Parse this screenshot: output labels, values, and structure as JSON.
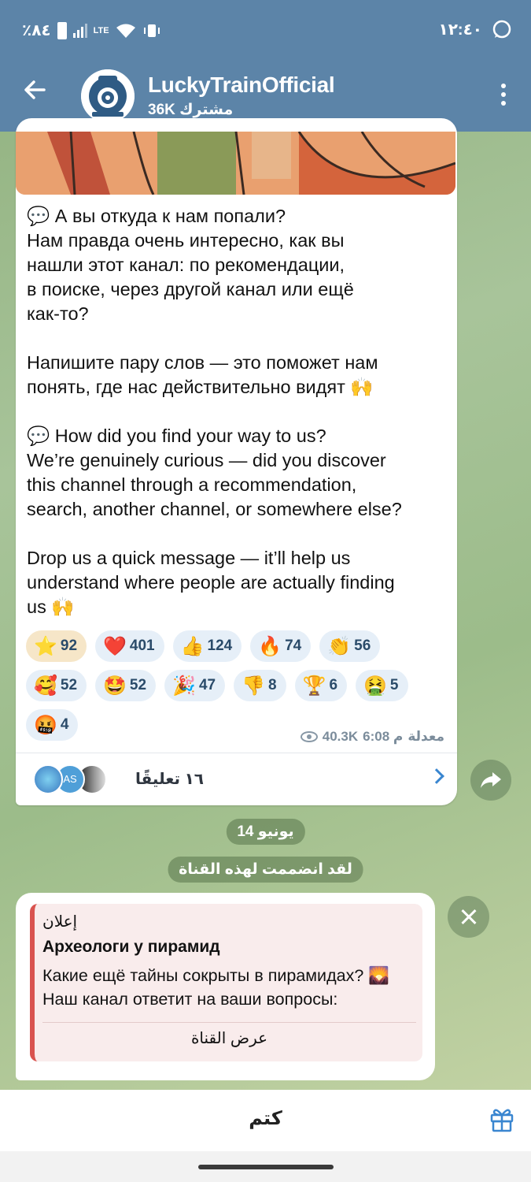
{
  "status_bar": {
    "battery": "٪٨٤",
    "network": "LTE",
    "time": "١٢:٤٠",
    "whatsapp_icon": "whatsapp-icon"
  },
  "header": {
    "title": "LuckyTrainOfficial",
    "subscribers": "36K مشترك"
  },
  "message": {
    "paragraphs": [
      "💬 А вы откуда к нам попали?\nНам правда очень интересно, как вы\nнашли этот канал: по рекомендации,\nв поиске, через другой канал или ещё\nкак-то?",
      "Напишите пару слов — это поможет нам\nпонять, где нас действительно видят 🙌",
      "💬 How did you find your way to us?\nWe’re genuinely curious — did you discover\nthis channel through a recommendation,\nsearch, another channel, or somewhere else?",
      "Drop us a quick message — it’ll help us\nunderstand where people are actually finding\nus 🙌"
    ],
    "reactions": [
      {
        "emoji": "⭐",
        "count": "92",
        "selected": true
      },
      {
        "emoji": "❤️",
        "count": "401"
      },
      {
        "emoji": "👍",
        "count": "124"
      },
      {
        "emoji": "🔥",
        "count": "74"
      },
      {
        "emoji": "👏",
        "count": "56"
      },
      {
        "emoji": "🥰",
        "count": "52"
      },
      {
        "emoji": "🤩",
        "count": "52"
      },
      {
        "emoji": "🎉",
        "count": "47"
      },
      {
        "emoji": "👎",
        "count": "8"
      },
      {
        "emoji": "🏆",
        "count": "6"
      },
      {
        "emoji": "🤮",
        "count": "5"
      },
      {
        "emoji": "🤬",
        "count": "4"
      }
    ],
    "views": "40.3K",
    "time": "6:08 م",
    "edited": "معدلة",
    "comments_label": "١٦ تعليقًا",
    "comment_avatar_initials": "AS"
  },
  "date_pill": "14 يونيو",
  "joined_pill": "لقد انضممت لهذه القناة",
  "sponsored": {
    "tag": "إعلان",
    "title": "Археологи у пирамид",
    "text": "Какие ещё тайны сокрыты в пирамидах? 🌄\nНаш канал ответит на ваши вопросы:",
    "button": "عرض القناة"
  },
  "bottom": {
    "mute": "كتم"
  },
  "colors": {
    "header": "#5c84a8",
    "reaction_bg": "#e6eff8",
    "accent_link": "#3a86d0",
    "sponsor_border": "#d9534f"
  }
}
